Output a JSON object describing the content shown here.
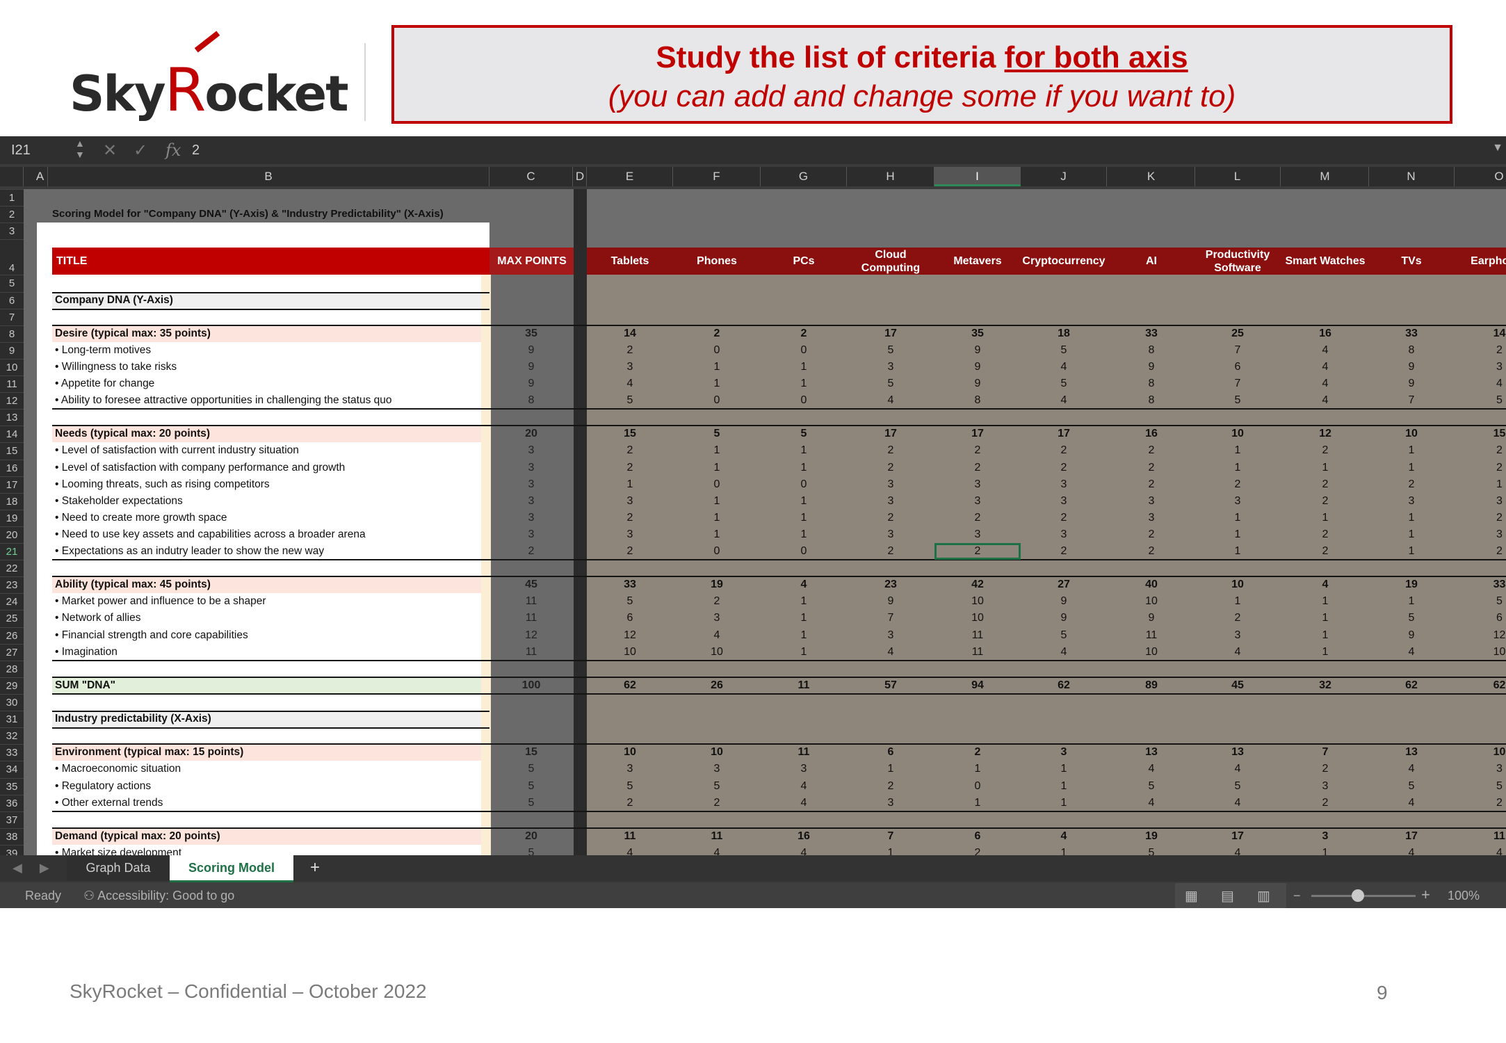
{
  "logo": {
    "text_pre": "Sky",
    "text_r": "R",
    "text_post": "ocket"
  },
  "banner": {
    "line1_pre": "Study the list of criteria ",
    "line1_underlined": "for both axis",
    "line2": "(you can add and change some if you want to)"
  },
  "formula_bar": {
    "name_box": "I21",
    "cancel_icon": "✕",
    "enter_icon": "✓",
    "fx_label": "fx",
    "value": "2"
  },
  "selected": {
    "col": "I",
    "row": 21
  },
  "columns": [
    "A",
    "B",
    "C",
    "D",
    "E",
    "F",
    "G",
    "H",
    "I",
    "J",
    "K",
    "L",
    "M",
    "N",
    "O"
  ],
  "sheet": {
    "title_cell": "Scoring Model for \"Company DNA\" (Y-Axis) & \"Industry Predictability\" (X-Axis)",
    "header_title": "TITLE",
    "header_max": "MAX POINTS",
    "categories": [
      "Tablets",
      "Phones",
      "PCs",
      "Cloud Computing",
      "Metavers",
      "Cryptocurrency",
      "AI",
      "Productivity Software",
      "Smart Watches",
      "TVs",
      "Earphones"
    ],
    "rows": [
      {
        "r": 6,
        "label": "Company DNA (Y-Axis)",
        "kind": "section"
      },
      {
        "r": 8,
        "label": "Desire (typical max: 35 points)",
        "kind": "group",
        "max": "35",
        "vals": [
          "14",
          "2",
          "2",
          "17",
          "35",
          "18",
          "33",
          "25",
          "16",
          "33",
          "14"
        ]
      },
      {
        "r": 9,
        "label": "• Long-term motives",
        "kind": "item",
        "max": "9",
        "vals": [
          "2",
          "0",
          "0",
          "5",
          "9",
          "5",
          "8",
          "7",
          "4",
          "8",
          "2"
        ]
      },
      {
        "r": 10,
        "label": "• Willingness to take risks",
        "kind": "item",
        "max": "9",
        "vals": [
          "3",
          "1",
          "1",
          "3",
          "9",
          "4",
          "9",
          "6",
          "4",
          "9",
          "3"
        ]
      },
      {
        "r": 11,
        "label": "• Appetite for change",
        "kind": "item",
        "max": "9",
        "vals": [
          "4",
          "1",
          "1",
          "5",
          "9",
          "5",
          "8",
          "7",
          "4",
          "9",
          "4"
        ]
      },
      {
        "r": 12,
        "label": "• Ability to foresee attractive opportunities in challenging the status quo",
        "kind": "item",
        "max": "8",
        "vals": [
          "5",
          "0",
          "0",
          "4",
          "8",
          "4",
          "8",
          "5",
          "4",
          "7",
          "5"
        ]
      },
      {
        "r": 14,
        "label": "Needs (typical max: 20 points)",
        "kind": "group",
        "max": "20",
        "vals": [
          "15",
          "5",
          "5",
          "17",
          "17",
          "17",
          "16",
          "10",
          "12",
          "10",
          "15"
        ]
      },
      {
        "r": 15,
        "label": "• Level of satisfaction with current industry situation",
        "kind": "item",
        "max": "3",
        "vals": [
          "2",
          "1",
          "1",
          "2",
          "2",
          "2",
          "2",
          "1",
          "2",
          "1",
          "2"
        ]
      },
      {
        "r": 16,
        "label": "• Level of satisfaction with company performance and growth",
        "kind": "item",
        "max": "3",
        "vals": [
          "2",
          "1",
          "1",
          "2",
          "2",
          "2",
          "2",
          "1",
          "1",
          "1",
          "2"
        ]
      },
      {
        "r": 17,
        "label": "• Looming threats, such as rising competitors",
        "kind": "item",
        "max": "3",
        "vals": [
          "1",
          "0",
          "0",
          "3",
          "3",
          "3",
          "2",
          "2",
          "2",
          "2",
          "1"
        ]
      },
      {
        "r": 18,
        "label": "• Stakeholder expectations",
        "kind": "item",
        "max": "3",
        "vals": [
          "3",
          "1",
          "1",
          "3",
          "3",
          "3",
          "3",
          "3",
          "2",
          "3",
          "3"
        ]
      },
      {
        "r": 19,
        "label": "• Need to create more growth space",
        "kind": "item",
        "max": "3",
        "vals": [
          "2",
          "1",
          "1",
          "2",
          "2",
          "2",
          "3",
          "1",
          "1",
          "1",
          "2"
        ]
      },
      {
        "r": 20,
        "label": "• Need to use key assets and capabilities across a broader arena",
        "kind": "item",
        "max": "3",
        "vals": [
          "3",
          "1",
          "1",
          "3",
          "3",
          "3",
          "2",
          "1",
          "2",
          "1",
          "3"
        ]
      },
      {
        "r": 21,
        "label": "• Expectations as an indutry leader to show the new way",
        "kind": "item",
        "max": "2",
        "vals": [
          "2",
          "0",
          "0",
          "2",
          "2",
          "2",
          "2",
          "1",
          "2",
          "1",
          "2"
        ]
      },
      {
        "r": 23,
        "label": "Ability (typical max: 45 points)",
        "kind": "group",
        "max": "45",
        "vals": [
          "33",
          "19",
          "4",
          "23",
          "42",
          "27",
          "40",
          "10",
          "4",
          "19",
          "33"
        ]
      },
      {
        "r": 24,
        "label": "• Market power and influence to be a shaper",
        "kind": "item",
        "max": "11",
        "vals": [
          "5",
          "2",
          "1",
          "9",
          "10",
          "9",
          "10",
          "1",
          "1",
          "1",
          "5"
        ]
      },
      {
        "r": 25,
        "label": "• Network of allies",
        "kind": "item",
        "max": "11",
        "vals": [
          "6",
          "3",
          "1",
          "7",
          "10",
          "9",
          "9",
          "2",
          "1",
          "5",
          "6"
        ]
      },
      {
        "r": 26,
        "label": "• Financial strength and core capabilities",
        "kind": "item",
        "max": "12",
        "vals": [
          "12",
          "4",
          "1",
          "3",
          "11",
          "5",
          "11",
          "3",
          "1",
          "9",
          "12"
        ]
      },
      {
        "r": 27,
        "label": "• Imagination",
        "kind": "item",
        "max": "11",
        "vals": [
          "10",
          "10",
          "1",
          "4",
          "11",
          "4",
          "10",
          "4",
          "1",
          "4",
          "10"
        ]
      },
      {
        "r": 29,
        "label": "SUM \"DNA\"",
        "kind": "sum",
        "max": "100",
        "vals": [
          "62",
          "26",
          "11",
          "57",
          "94",
          "62",
          "89",
          "45",
          "32",
          "62",
          "62"
        ]
      },
      {
        "r": 31,
        "label": "Industry predictability (X-Axis)",
        "kind": "section"
      },
      {
        "r": 33,
        "label": "Environment (typical max: 15 points)",
        "kind": "group",
        "max": "15",
        "vals": [
          "10",
          "10",
          "11",
          "6",
          "2",
          "3",
          "13",
          "13",
          "7",
          "13",
          "10"
        ]
      },
      {
        "r": 34,
        "label": "• Macroeconomic situation",
        "kind": "item",
        "max": "5",
        "vals": [
          "3",
          "3",
          "3",
          "1",
          "1",
          "1",
          "4",
          "4",
          "2",
          "4",
          "3"
        ]
      },
      {
        "r": 35,
        "label": "• Regulatory actions",
        "kind": "item",
        "max": "5",
        "vals": [
          "5",
          "5",
          "4",
          "2",
          "0",
          "1",
          "5",
          "5",
          "3",
          "5",
          "5"
        ]
      },
      {
        "r": 36,
        "label": "• Other external trends",
        "kind": "item",
        "max": "5",
        "vals": [
          "2",
          "2",
          "4",
          "3",
          "1",
          "1",
          "4",
          "4",
          "2",
          "4",
          "2"
        ]
      },
      {
        "r": 38,
        "label": "Demand (typical max: 20 points)",
        "kind": "group",
        "max": "20",
        "vals": [
          "11",
          "11",
          "16",
          "7",
          "6",
          "4",
          "19",
          "17",
          "3",
          "17",
          "11"
        ]
      },
      {
        "r": 39,
        "label": "• Market size development",
        "kind": "item",
        "max": "5",
        "vals": [
          "4",
          "4",
          "4",
          "1",
          "2",
          "1",
          "5",
          "4",
          "1",
          "4",
          "4"
        ]
      }
    ]
  },
  "tabs": {
    "sheet1": "Graph Data",
    "sheet2": "Scoring Model",
    "add": "+"
  },
  "status": {
    "ready": "Ready",
    "accessibility": "Accessibility: Good to go",
    "zoom": "100%",
    "zoom_minus": "−",
    "zoom_plus": "+"
  },
  "footer": {
    "text": "SkyRocket – Confidential – October 2022",
    "page": "9"
  },
  "colors": {
    "red": "#c00000",
    "group_bg": "#fde4dc",
    "sum_bg": "#e2efda",
    "section_bg": "#f0f0f0",
    "data_bg": "#8f867b",
    "header_red": "#c00000"
  }
}
